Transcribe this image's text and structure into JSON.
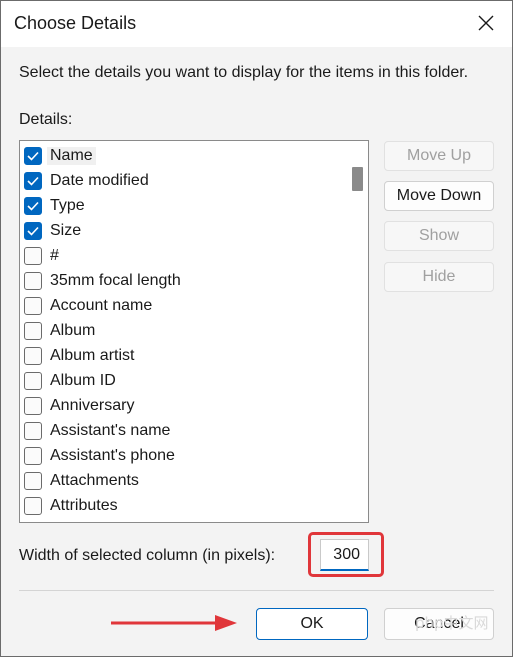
{
  "dialog": {
    "title": "Choose Details",
    "description": "Select the details you want to display for the items in this folder.",
    "details_label": "Details:"
  },
  "items": [
    {
      "label": "Name",
      "checked": true
    },
    {
      "label": "Date modified",
      "checked": true
    },
    {
      "label": "Type",
      "checked": true
    },
    {
      "label": "Size",
      "checked": true
    },
    {
      "label": "#",
      "checked": false
    },
    {
      "label": "35mm focal length",
      "checked": false
    },
    {
      "label": "Account name",
      "checked": false
    },
    {
      "label": "Album",
      "checked": false
    },
    {
      "label": "Album artist",
      "checked": false
    },
    {
      "label": "Album ID",
      "checked": false
    },
    {
      "label": "Anniversary",
      "checked": false
    },
    {
      "label": "Assistant's name",
      "checked": false
    },
    {
      "label": "Assistant's phone",
      "checked": false
    },
    {
      "label": "Attachments",
      "checked": false
    },
    {
      "label": "Attributes",
      "checked": false
    },
    {
      "label": "",
      "checked": false
    }
  ],
  "buttons": {
    "move_up": "Move Up",
    "move_down": "Move Down",
    "show": "Show",
    "hide": "Hide",
    "ok": "OK",
    "cancel": "Cancel"
  },
  "width": {
    "label": "Width of selected column (in pixels):",
    "value": "300"
  },
  "watermark": "php中文网",
  "colors": {
    "accent": "#0067c0",
    "highlight": "#e0363a"
  }
}
